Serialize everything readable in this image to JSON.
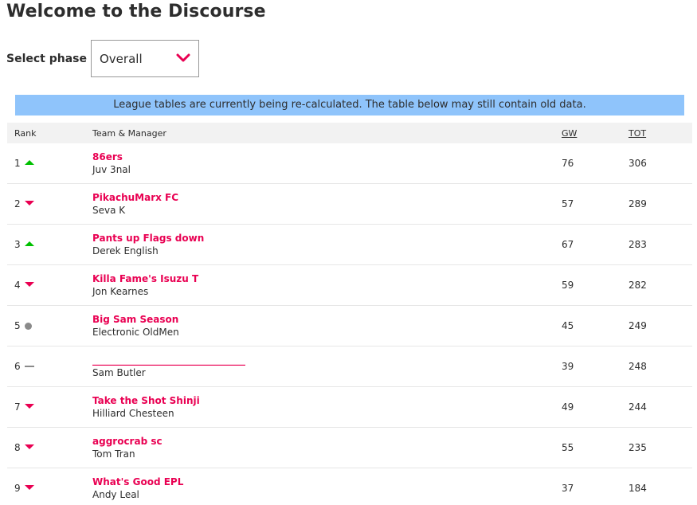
{
  "page": {
    "title": "Welcome to the Discourse"
  },
  "phase": {
    "label": "Select phase",
    "selected": "Overall"
  },
  "notice": {
    "text": "League tables are currently being re-calculated. The table below may still contain old data."
  },
  "table": {
    "headers": {
      "rank": "Rank",
      "team": "Team & Manager",
      "gw": "GW",
      "tot": "TOT"
    },
    "rows": [
      {
        "rank": "1",
        "movement": "up",
        "team": "86ers",
        "manager": "Juv 3nal",
        "gw": "76",
        "tot": "306"
      },
      {
        "rank": "2",
        "movement": "down",
        "team": "PikachuMarx FC",
        "manager": "Seva K",
        "gw": "57",
        "tot": "289"
      },
      {
        "rank": "3",
        "movement": "up",
        "team": "Pants up Flags down",
        "manager": "Derek English",
        "gw": "67",
        "tot": "283"
      },
      {
        "rank": "4",
        "movement": "down",
        "team": "Killa Fame's Isuzu T",
        "manager": "Jon Kearnes",
        "gw": "59",
        "tot": "282"
      },
      {
        "rank": "5",
        "movement": "same",
        "team": "Big Sam Season",
        "manager": "Electronic OldMen",
        "gw": "45",
        "tot": "249"
      },
      {
        "rank": "6",
        "movement": "new",
        "team": "________________________________",
        "manager": "Sam Butler",
        "gw": "39",
        "tot": "248"
      },
      {
        "rank": "7",
        "movement": "down",
        "team": "Take the Shot Shinji",
        "manager": "Hilliard Chesteen",
        "gw": "49",
        "tot": "244"
      },
      {
        "rank": "8",
        "movement": "down",
        "team": "aggrocrab sc",
        "manager": "Tom Tran",
        "gw": "55",
        "tot": "235"
      },
      {
        "rank": "9",
        "movement": "down",
        "team": "What's Good EPL",
        "manager": "Andy Leal",
        "gw": "37",
        "tot": "184"
      }
    ]
  },
  "colors": {
    "accent": "#e90052",
    "up": "#00c000",
    "notice_bg": "#8fc4fb",
    "header_bg": "#f2f2f2"
  },
  "icons": {
    "dropdown": "chevron-down-icon",
    "up": "arrow-up-icon",
    "down": "arrow-down-icon",
    "same": "circle-icon",
    "new": "dash-icon"
  }
}
